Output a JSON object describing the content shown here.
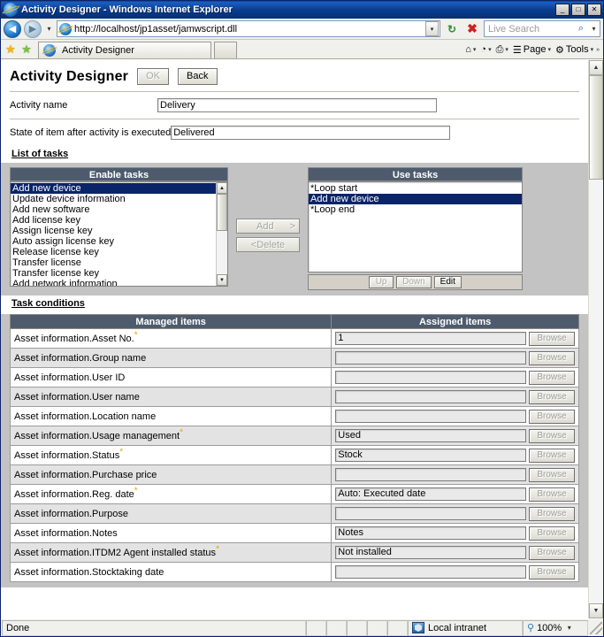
{
  "window": {
    "title": "Activity Designer - Windows Internet Explorer",
    "minimize_label": "_",
    "maximize_label": "□",
    "close_label": "✕"
  },
  "address_bar": {
    "back_label": "◀",
    "forward_label": "▶",
    "recent_dropdown_label": "▾",
    "url": "http://localhost/jp1asset/jamwscript.dll",
    "url_dropdown_label": "▾",
    "refresh_label": "↻",
    "stop_label": "✖",
    "search_placeholder": "Live Search",
    "search_button_label": "⌕",
    "search_dropdown_label": "▾"
  },
  "tab_bar": {
    "favorites_add_label": "★",
    "favorites_bar_label": "★",
    "tabs": [
      {
        "title": "Activity Designer"
      }
    ],
    "new_tab_label": "",
    "toolbar_items": [
      {
        "name": "home",
        "label": "",
        "icon": "⌂",
        "has_chevron": true
      },
      {
        "name": "feeds",
        "label": "",
        "icon": "◔",
        "has_chevron": true
      },
      {
        "name": "print",
        "label": "",
        "icon": "⎙",
        "has_chevron": true
      },
      {
        "name": "page",
        "label": "Page",
        "icon": "☰",
        "has_chevron": true
      },
      {
        "name": "tools",
        "label": "Tools",
        "icon": "⚙",
        "has_chevron": true
      }
    ],
    "overflow_label": "»"
  },
  "app": {
    "title": "Activity Designer",
    "ok_label": "OK",
    "back_label": "Back"
  },
  "fields": {
    "activity_name": {
      "label": "Activity name",
      "value": "Delivery"
    },
    "state_after": {
      "label": "State of item after activity is executed",
      "value": "Delivered"
    }
  },
  "tasks": {
    "section_title": "List of tasks",
    "enable_tasks": {
      "header": "Enable tasks",
      "items": [
        "Add new device",
        "Update device information",
        "Add new software",
        "Add license key",
        "Assign license key",
        "Auto assign license key",
        "Release license key",
        "Transfer license",
        "Transfer license key",
        "Add network information"
      ],
      "selected_index": 0,
      "scroll_up_label": "▲",
      "scroll_down_label": "▼"
    },
    "transfer_buttons": {
      "add_label": "Add",
      "add_arrow": ">",
      "delete_label": "<Delete"
    },
    "use_tasks": {
      "header": "Use tasks",
      "items": [
        "*Loop start",
        "Add new device",
        "*Loop end"
      ],
      "selected_index": 1,
      "buttons": [
        {
          "label": "Up",
          "enabled": false
        },
        {
          "label": "Down",
          "enabled": false
        },
        {
          "label": "Edit",
          "enabled": true
        }
      ]
    }
  },
  "task_conditions": {
    "section_title": "Task conditions",
    "columns": [
      "Managed items",
      "Assigned items"
    ],
    "browse_label": "Browse",
    "required_marker": "*",
    "rows": [
      {
        "item": "Asset information.Asset No.",
        "required": true,
        "value": "1"
      },
      {
        "item": "Asset information.Group name",
        "required": false,
        "value": ""
      },
      {
        "item": "Asset information.User ID",
        "required": false,
        "value": ""
      },
      {
        "item": "Asset information.User name",
        "required": false,
        "value": ""
      },
      {
        "item": "Asset information.Location name",
        "required": false,
        "value": ""
      },
      {
        "item": "Asset information.Usage management",
        "required": true,
        "value": "Used"
      },
      {
        "item": "Asset information.Status",
        "required": true,
        "value": "Stock"
      },
      {
        "item": "Asset information.Purchase price",
        "required": false,
        "value": ""
      },
      {
        "item": "Asset information.Reg. date",
        "required": true,
        "value": "Auto: Executed date"
      },
      {
        "item": "Asset information.Purpose",
        "required": false,
        "value": ""
      },
      {
        "item": "Asset information.Notes",
        "required": false,
        "value": "Notes"
      },
      {
        "item": "Asset information.ITDM2 Agent installed status",
        "required": true,
        "value": "Not installed"
      },
      {
        "item": "Asset information.Stocktaking date",
        "required": false,
        "value": ""
      }
    ]
  },
  "status_bar": {
    "status_text": "Done",
    "zone_text": "Local intranet",
    "zoom_text": "100%",
    "zoom_dropdown_label": "▾"
  },
  "scrollbar": {
    "up_label": "▲",
    "down_label": "▼"
  },
  "colors": {
    "titlebar": "#0a3d91",
    "table_header": "#4d5b6d",
    "selection": "#0a246a",
    "required_marker": "#f0a000",
    "panel_bg": "#c3c3c3"
  }
}
